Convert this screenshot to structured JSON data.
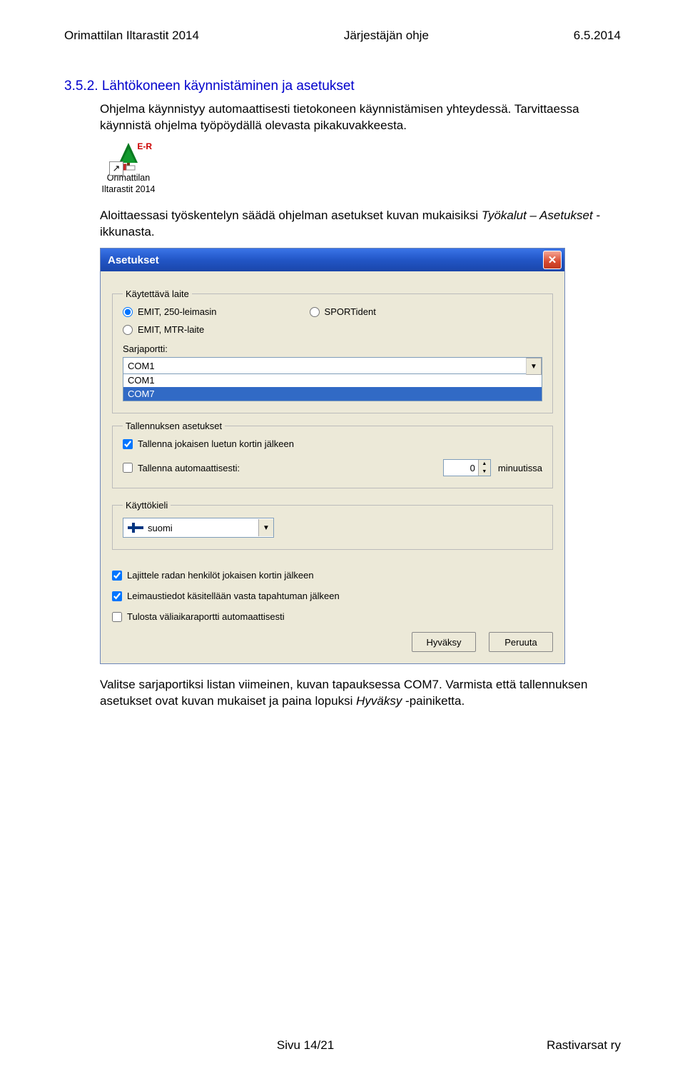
{
  "header": {
    "left": "Orimattilan Iltarastit 2014",
    "center": "Järjestäjän ohje",
    "right": "6.5.2014"
  },
  "section": {
    "number": "3.5.2.",
    "title": "Lähtökoneen käynnistäminen ja asetukset"
  },
  "para1": "Ohjelma käynnistyy automaattisesti tietokoneen käynnistämisen yhteydessä. Tarvittaessa käynnistä ohjelma työpöydällä olevasta pikakuvakkeesta.",
  "shortcut": {
    "badge": "E-R",
    "label1": "Orimattilan",
    "label2": "Iltarastit 2014"
  },
  "para2_pre": "Aloittaessasi työskentelyn säädä ohjelman asetukset kuvan mukaisiksi ",
  "para2_italic": "Työkalut – Asetukset",
  "para2_post": " -ikkunasta.",
  "dialog": {
    "title": "Asetukset",
    "group_device": {
      "legend": "Käytettävä laite",
      "opt_emit250": "EMIT, 250-leimasin",
      "opt_sportident": "SPORTident",
      "opt_emitmtr": "EMIT, MTR-laite",
      "selected": "emit250"
    },
    "serial": {
      "label": "Sarjaportti:",
      "value": "COM1",
      "options": [
        "COM1",
        "COM7"
      ],
      "highlighted": "COM7"
    },
    "group_save": {
      "legend": "Tallennuksen asetukset",
      "chk_after_each": "Tallenna jokaisen luetun kortin jälkeen",
      "chk_after_each_checked": true,
      "chk_auto": "Tallenna automaattisesti:",
      "chk_auto_checked": false,
      "auto_value": "0",
      "auto_unit": "minuutissa"
    },
    "group_lang": {
      "legend": "Käyttökieli",
      "value": "suomi"
    },
    "checks": {
      "sort": "Lajittele radan henkilöt jokaisen kortin jälkeen",
      "sort_checked": true,
      "stamp": "Leimaustiedot käsitellään vasta tapahtuman jälkeen",
      "stamp_checked": true,
      "print": "Tulosta väliaikaraportti automaattisesti",
      "print_checked": false
    },
    "buttons": {
      "ok": "Hyväksy",
      "cancel": "Peruuta"
    }
  },
  "para3_pre": "Valitse sarjaportiksi listan viimeinen, kuvan tapauksessa COM7. Varmista että tallennuksen asetukset ovat kuvan mukaiset ja paina lopuksi ",
  "para3_italic": "Hyväksy",
  "para3_post": " -painiketta.",
  "footer": {
    "center": "Sivu 14/21",
    "right": "Rastivarsat ry"
  }
}
